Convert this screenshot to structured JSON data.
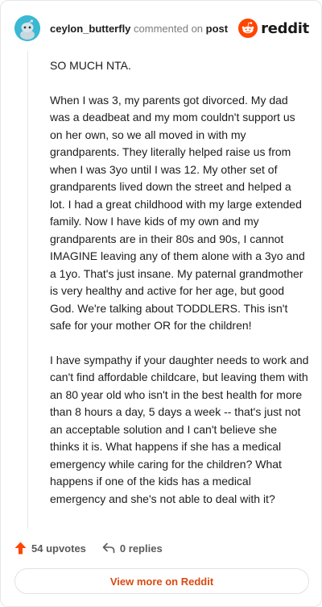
{
  "header": {
    "username": "ceylon_butterfly",
    "commented_on": "commented on",
    "post_link": "post",
    "brand": "reddit"
  },
  "comment": {
    "paragraphs": [
      "SO MUCH NTA.",
      "When I was 3, my parents got divorced. My dad was a deadbeat and my mom couldn't support us on her own, so we all moved in with my grandparents. They literally helped raise us from when I was 3yo until I was 12. My other set of grandparents lived down the street and helped a lot. I had a great childhood with my large extended family. Now I have kids of my own and my grandparents are in their 80s and 90s, I cannot IMAGINE leaving any of them alone with a 3yo and a 1yo. That's just insane. My paternal grandmother is very healthy and active for her age, but good God. We're talking about TODDLERS. This isn't safe for your mother OR for the children!",
      "I have sympathy if your daughter needs to work and can't find affordable childcare, but leaving them with an 80 year old who isn't in the best health for more than 8 hours a day, 5 days a week -- that's just not an acceptable solution and I can't believe she thinks it is. What happens if she has a medical emergency while caring for the children? What happens if one of the kids has a medical emergency and she's not able to deal with it?"
    ]
  },
  "actions": {
    "upvotes": "54 upvotes",
    "replies": "0 replies"
  },
  "footer": {
    "view_more": "View more on Reddit"
  },
  "colors": {
    "avatar_bg": "#3ab8d4",
    "reddit_orange": "#ff4500",
    "upvote_orange": "#ff4500",
    "link_orange": "#d94a12"
  },
  "icons": {
    "avatar": "snoo-avatar-icon",
    "brand": "reddit-snoo-icon",
    "upvote": "upvote-arrow-icon",
    "reply": "reply-arrow-icon"
  }
}
